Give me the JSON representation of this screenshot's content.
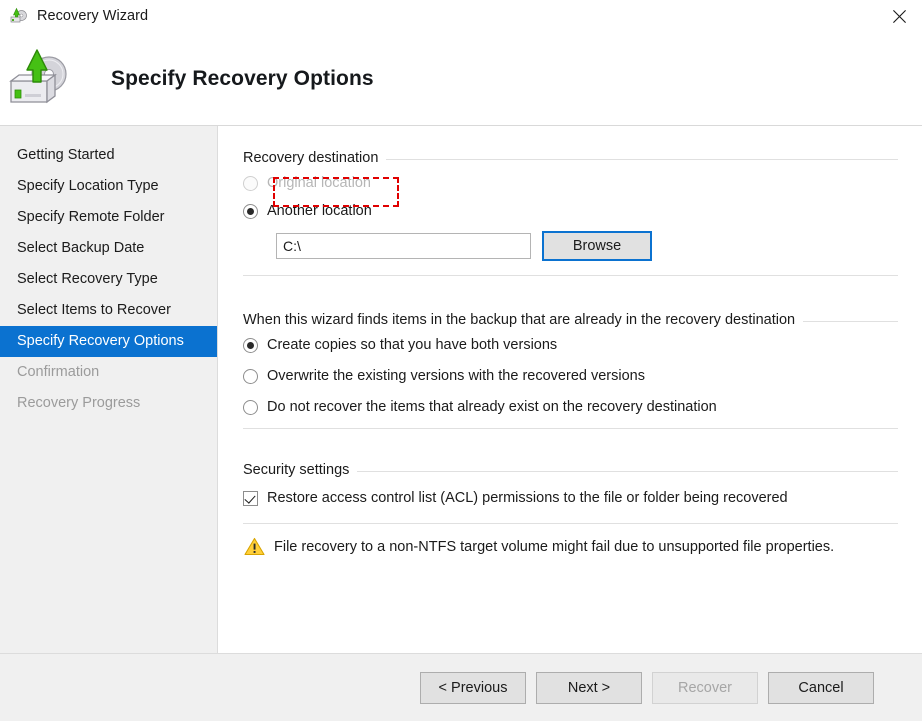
{
  "window": {
    "title": "Recovery Wizard",
    "title_icon": "recovery-disk-icon",
    "close_label": "✕"
  },
  "header": {
    "title": "Specify Recovery Options",
    "icon": "recovery-disk-large-icon"
  },
  "sidebar": {
    "items": [
      {
        "label": "Getting Started",
        "state": "normal"
      },
      {
        "label": "Specify Location Type",
        "state": "normal"
      },
      {
        "label": "Specify Remote Folder",
        "state": "normal"
      },
      {
        "label": "Select Backup Date",
        "state": "normal"
      },
      {
        "label": "Select Recovery Type",
        "state": "normal"
      },
      {
        "label": "Select Items to Recover",
        "state": "normal"
      },
      {
        "label": "Specify Recovery Options",
        "state": "active"
      },
      {
        "label": "Confirmation",
        "state": "disabled"
      },
      {
        "label": "Recovery Progress",
        "state": "disabled"
      }
    ]
  },
  "destination": {
    "group_title": "Recovery destination",
    "original_location_label": "Original location",
    "original_location_selected": false,
    "original_location_disabled": true,
    "another_location_label": "Another location",
    "another_location_selected": true,
    "path_value": "C:\\",
    "path_placeholder": "",
    "browse_label": "Browse"
  },
  "conflict": {
    "group_title": "When this wizard finds items in the backup that are already in the recovery destination",
    "options": [
      {
        "label": "Create copies so that you have both versions",
        "selected": true
      },
      {
        "label": "Overwrite the existing versions with the recovered versions",
        "selected": false
      },
      {
        "label": "Do not recover the items that already exist on the recovery destination",
        "selected": false
      }
    ]
  },
  "security": {
    "group_title": "Security settings",
    "acl_label": "Restore access control list (ACL) permissions to the file or folder being recovered",
    "acl_checked": true
  },
  "warning": {
    "icon": "warning-triangle-icon",
    "text": "File recovery to a non-NTFS target volume might fail due to unsupported file properties."
  },
  "footer": {
    "previous_label": "< Previous",
    "next_label": "Next >",
    "recover_label": "Recover",
    "recover_disabled": true,
    "cancel_label": "Cancel"
  },
  "annotation": {
    "type": "red-dashed-highlight",
    "target": "original-location-label"
  },
  "colors": {
    "accent": "#0b72d0",
    "annotation": "#e00000",
    "warning": "#ffcc00",
    "sidebar_bg": "#f0f0f0",
    "footer_bg": "#f0f0f0"
  }
}
